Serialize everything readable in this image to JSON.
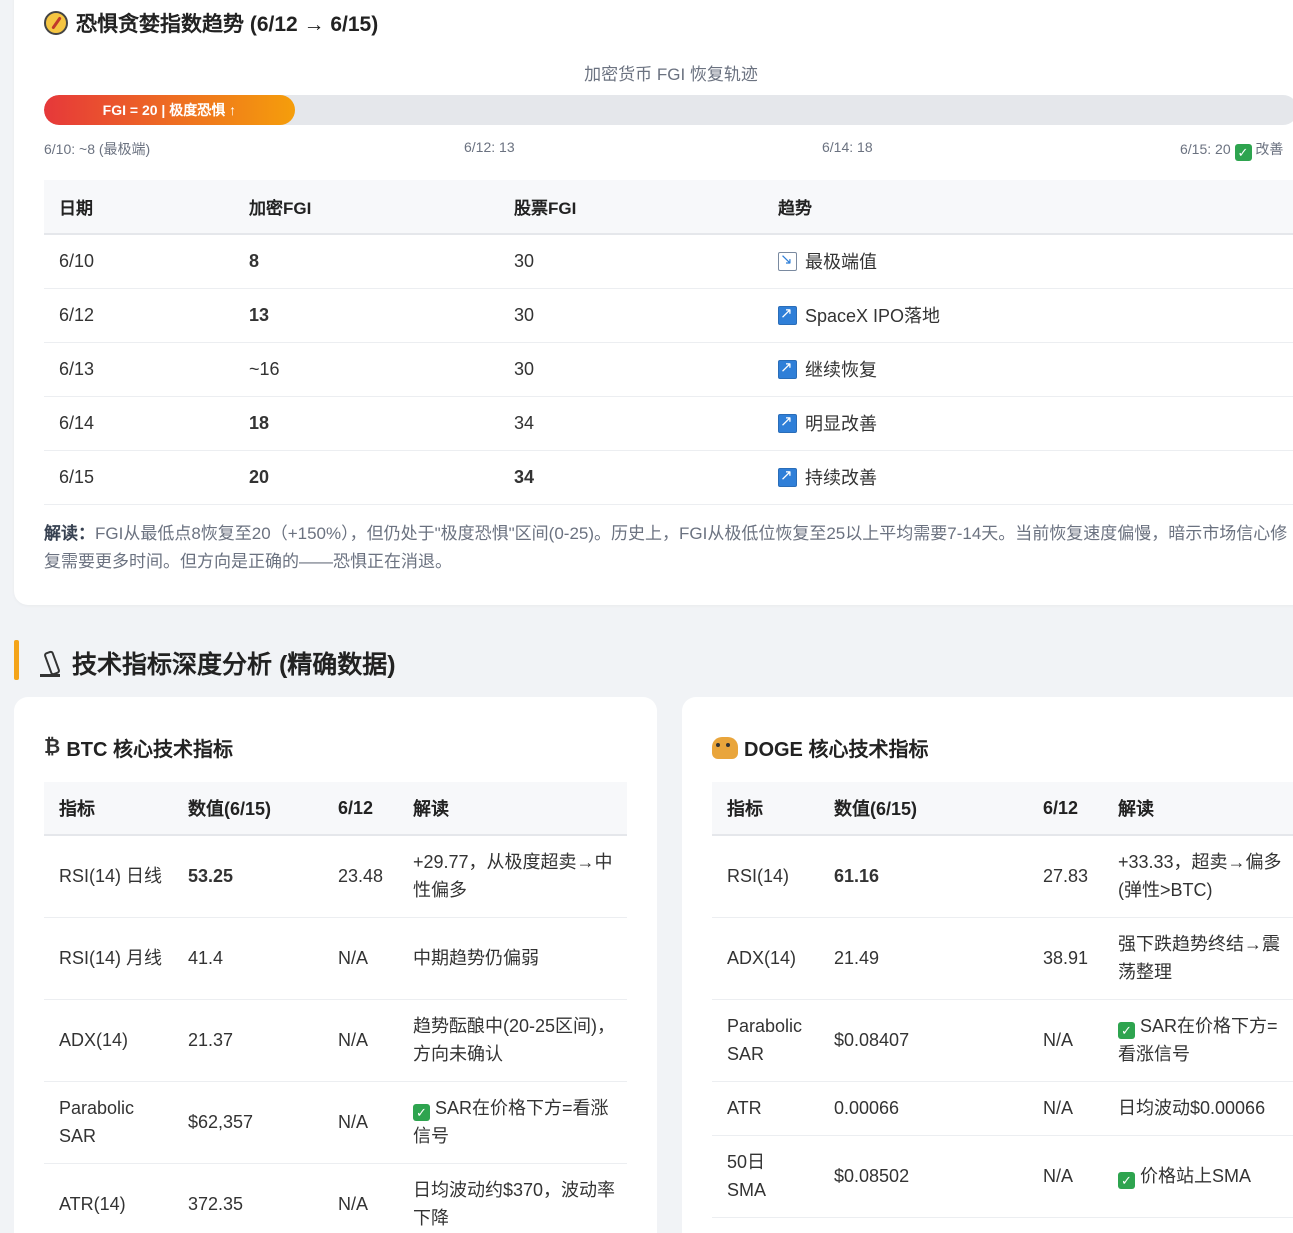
{
  "fgi_section": {
    "title": "恐惧贪婪指数趋势 (6/12 → 6/15)",
    "track_caption": "加密货币 FGI 恢复轨迹",
    "progress_label": "FGI = 20 | 极度恐惧 ↑",
    "progress_value": 20,
    "progress_max": 100,
    "milestones": [
      "6/10: ~8 (最极端)",
      "6/12: 13",
      "6/14: 18",
      "6/15: 20",
      "改善"
    ],
    "table_headers": [
      "日期",
      "加密FGI",
      "股票FGI",
      "趋势"
    ],
    "rows": [
      {
        "date": "6/10",
        "crypto": "8",
        "stock": "30",
        "trend": "最极端值",
        "trend_icon": "chart-down-icon"
      },
      {
        "date": "6/12",
        "crypto": "13",
        "stock": "30",
        "trend": "SpaceX IPO落地",
        "trend_icon": "chart-up-icon"
      },
      {
        "date": "6/13",
        "crypto": "~16",
        "stock": "30",
        "trend": "继续恢复",
        "trend_icon": "chart-up-icon"
      },
      {
        "date": "6/14",
        "crypto": "18",
        "stock": "34",
        "trend": "明显改善",
        "trend_icon": "chart-up-icon"
      },
      {
        "date": "6/15",
        "crypto": "20",
        "stock": "34",
        "trend": "持续改善",
        "trend_icon": "chart-up-icon"
      }
    ],
    "note_label": "解读：",
    "note_text": "FGI从最低点8恢复至20（+150%），但仍处于\"极度恐惧\"区间(0-25)。历史上，FGI从极低位恢复至25以上平均需要7-14天。当前恢复速度偏慢，暗示市场信心修复需要更多时间。但方向是正确的——恐惧正在消退。"
  },
  "tech_section": {
    "title": "技术指标深度分析 (精确数据)"
  },
  "btc": {
    "symbol": "₿",
    "title": "BTC 核心技术指标",
    "headers": [
      "指标",
      "数值(6/15)",
      "6/12",
      "解读"
    ],
    "rows": [
      {
        "name": "RSI(14) 日线",
        "value": "53.25",
        "prev": "23.48",
        "note": "+29.77，从极度超卖→中性偏多"
      },
      {
        "name": "RSI(14) 月线",
        "value": "41.4",
        "prev": "N/A",
        "note": "中期趋势仍偏弱"
      },
      {
        "name": "ADX(14)",
        "value": "21.37",
        "prev": "N/A",
        "note": "趋势酝酿中(20-25区间)，方向未确认"
      },
      {
        "name": "Parabolic SAR",
        "value": "$62,357",
        "prev": "N/A",
        "note": "SAR在价格下方=看涨信号"
      },
      {
        "name": "ATR(14)",
        "value": "372.35",
        "prev": "N/A",
        "note": "日均波动约$370，波动率下降"
      }
    ]
  },
  "doge": {
    "title": "DOGE 核心技术指标",
    "headers": [
      "指标",
      "数值(6/15)",
      "6/12",
      "解读"
    ],
    "rows": [
      {
        "name": "RSI(14)",
        "value": "61.16",
        "prev": "27.83",
        "note": "+33.33，超卖→偏多(弹性>BTC)"
      },
      {
        "name": "ADX(14)",
        "value": "21.49",
        "prev": "38.91",
        "note": "强下跌趋势终结→震荡整理"
      },
      {
        "name": "Parabolic SAR",
        "value": "$0.08407",
        "prev": "N/A",
        "note": "SAR在价格下方=看涨信号"
      },
      {
        "name": "ATR",
        "value": "0.00066",
        "prev": "N/A",
        "note": "日均波动$0.00066"
      },
      {
        "name": "50日 SMA",
        "value": "$0.08502",
        "prev": "N/A",
        "note": "价格站上SMA"
      }
    ]
  },
  "colors": {
    "red": "#e53e3e",
    "orange": "#e8a317",
    "green": "#3aa56b",
    "accent_bar": "#f4a41a"
  }
}
